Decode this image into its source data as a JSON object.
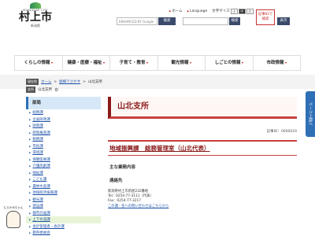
{
  "header": {
    "logo_en": "MURAKAMI CITY",
    "logo_name": "村上市",
    "logo_sub": "新潟県",
    "top_links": [
      "ホーム",
      "Language"
    ],
    "font_size_label": "文字サイズ",
    "font_sizes": [
      "小",
      "中",
      "大"
    ],
    "search_placeholder": "ENHANCED BY Google",
    "search_button": "検索",
    "print_label": "記事IDで検索",
    "show_button": "表示"
  },
  "gnav": [
    "くらしの情報",
    "健康・医療・福祉",
    "子育て・教育",
    "観光情報",
    "しごとの情報",
    "市政情報"
  ],
  "breadcrumb": {
    "tag": "現在地",
    "items": [
      "ホーム",
      "組織でさがす",
      "山北支所"
    ],
    "tag2": "支所",
    "current": "山北支所"
  },
  "side": {
    "heading": "部局",
    "items": [
      "総務課",
      "企画財政課",
      "財政課",
      "政策推進課",
      "税務課",
      "市民課",
      "環境課",
      "保健医療課",
      "介護高齢課",
      "福祉課",
      "こども課",
      "農林水産課",
      "地域経済振興課",
      "観光課",
      "建設課",
      "都市計画課",
      "上下水道課",
      "会計管理者・会計課",
      "教育委員会",
      "議会事務局",
      "選挙管理委員会"
    ]
  },
  "main": {
    "title": "山北支所",
    "record_id": "記事ID：0000020",
    "dept": "地域振興課　総務管理室（山北代表）",
    "section_title": "主な業務内容",
    "body": "",
    "contact_title": "連絡先",
    "contact_lines": [
      "新潟県村上市府屋232番地",
      "Tel：0254-77-3111（代表）",
      "Fax：0254-77-3217"
    ],
    "contact_link": "この課・室への問い合わせはこちらから"
  },
  "page_tab": "ページ上部へ",
  "mascot_label": "むらかみちゃん"
}
